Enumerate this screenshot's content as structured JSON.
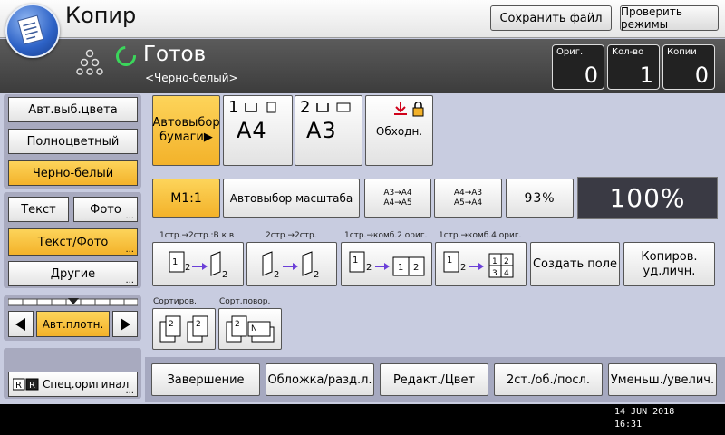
{
  "header": {
    "title": "Копир",
    "save_file": "Сохранить файл",
    "check_modes": "Проверить режимы"
  },
  "status": {
    "text": "Готов",
    "subtext": "<Черно-белый>",
    "counters": [
      {
        "label": "Ориг.",
        "value": "0"
      },
      {
        "label": "Кол-во",
        "value": "1"
      },
      {
        "label": "Копии",
        "value": "0"
      }
    ]
  },
  "left": {
    "auto_color": "Авт.выб.цвета",
    "full_color": "Полноцветный",
    "bw": "Черно-белый",
    "text": "Текст",
    "photo": "Фото",
    "text_photo": "Текст/Фото",
    "other": "Другие",
    "density": "Авт.плотн.",
    "special_original": "Спец.оригинал"
  },
  "paper": {
    "auto_line1": "Автовыбор",
    "auto_line2": "бумаги▶",
    "tray1_num": "1",
    "tray1_size": "A4",
    "tray2_num": "2",
    "tray2_size": "A3",
    "bypass": "Обходн."
  },
  "reduce": {
    "m1": "M1:1",
    "auto_scale": "Автовыбор масштаба",
    "a3a4_1": "A3→A4",
    "a3a4_2": "A4→A5",
    "a4a3_1": "A4→A3",
    "a4a3_2": "A5→A4",
    "pct": "93%",
    "ratio": "100%"
  },
  "duplex": {
    "l1": "1стр.→2стр.:В к в",
    "l2": "2стр.→2стр.",
    "l3": "1стр.→комб.2 ориг.",
    "l4": "1стр.→комб.4 ориг.",
    "create_field": "Создать поле",
    "id_copy_1": "Копиров.",
    "id_copy_2": "уд.личн."
  },
  "sort": {
    "l1": "Сортиров.",
    "l2": "Сорт.повор."
  },
  "bottom": {
    "finish": "Завершение",
    "cover": "Обложка/разд.л.",
    "edit_color": "Редакт./Цвет",
    "duplex": "2ст./об./посл.",
    "reduce_enlarge": "Уменьш./увелич."
  },
  "clock": {
    "date": "14 JUN  2018",
    "time": "16:31"
  },
  "colors": {
    "accent": "#f3b22a",
    "status_bg": "#4a4a4a",
    "panel_bg": "#c8cce0",
    "ready_green": "#3bd65b"
  }
}
